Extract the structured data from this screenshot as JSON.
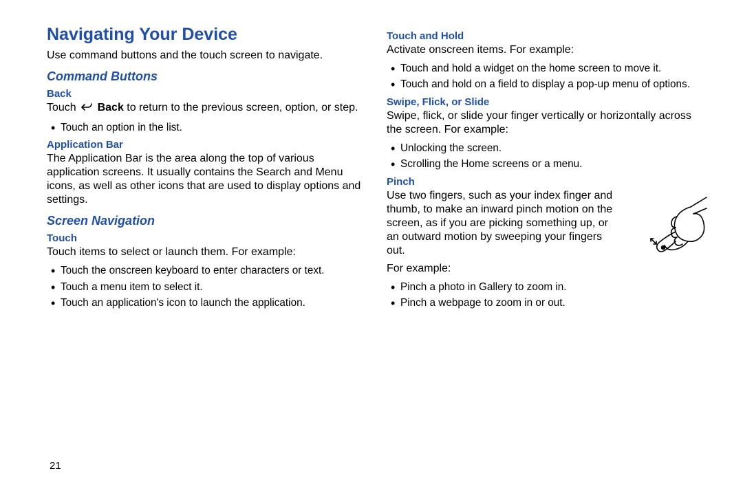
{
  "title": "Navigating Your Device",
  "intro": "Use command buttons and the touch screen to navigate.",
  "section_cmd": "Command Buttons",
  "back_head": "Back",
  "back_t1": "Touch ",
  "back_bold": " Back",
  "back_t2": " to return to the previous screen, option, or step.",
  "back_b1": "Touch an option in the list.",
  "appbar_head": "Application Bar",
  "appbar_body": "The Application Bar is the area along the top of various application screens. It usually contains the Search and Menu icons, as well as other icons that are used to display options and settings.",
  "section_nav": "Screen Navigation",
  "touch_head": "Touch",
  "touch_body": "Touch items to select or launch them. For example:",
  "touch_b1": "Touch the onscreen keyboard to enter characters or text.",
  "touch_b2": "Touch a menu item to select it.",
  "touch_b3": "Touch an application's icon to launch the application.",
  "thold_head": "Touch and Hold",
  "thold_body": "Activate onscreen items. For example:",
  "thold_b1": "Touch and hold a widget on the home screen to move it.",
  "thold_b2": "Touch and hold on a field to display a pop-up menu of options.",
  "swipe_head": "Swipe, Flick, or Slide",
  "swipe_body": "Swipe, flick, or slide your finger vertically or horizontally across the screen. For example:",
  "swipe_b1": "Unlocking the screen.",
  "swipe_b2": "Scrolling the Home screens or a menu.",
  "pinch_head": "Pinch",
  "pinch_body": "Use two fingers, such as your index finger and thumb, to make an inward pinch motion on the screen, as if you are picking something up, or an outward motion by sweeping your fingers out.",
  "pinch_eg": "For example:",
  "pinch_b1": "Pinch a photo in Gallery to zoom in.",
  "pinch_b2": "Pinch a webpage to zoom in or out.",
  "page_num": "21"
}
